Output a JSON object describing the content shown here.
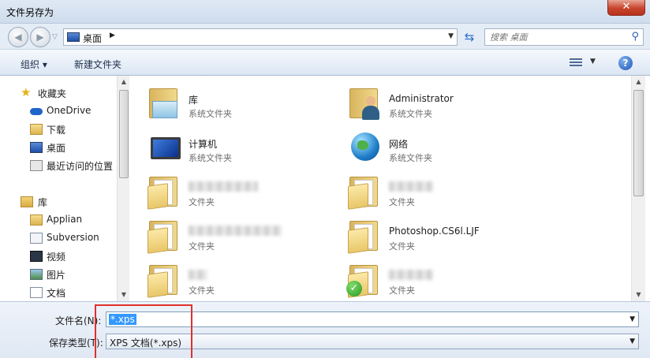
{
  "window": {
    "title": "文件另存为",
    "close_glyph": "✕"
  },
  "address": {
    "back_glyph": "◀",
    "forward_glyph": "▶",
    "crumb": "桌面",
    "crumb_arrow": "▶",
    "search_placeholder": "搜索 桌面"
  },
  "toolbar": {
    "organize": "组织 ▾",
    "new_folder": "新建文件夹",
    "help": "?"
  },
  "nav": {
    "favorites_label": "收藏夹",
    "items_favorites": [
      "OneDrive",
      "下载",
      "桌面",
      "最近访问的位置"
    ],
    "library_label": "库",
    "items_library": [
      "Applian",
      "Subversion",
      "视频",
      "图片",
      "文档"
    ]
  },
  "content": {
    "items": [
      {
        "name": "库",
        "type": "系统文件夹",
        "icon": "library-icon"
      },
      {
        "name": "Administrator",
        "type": "系统文件夹",
        "icon": "user-folder-icon"
      },
      {
        "name": "计算机",
        "type": "系统文件夹",
        "icon": "computer-icon"
      },
      {
        "name": "网络",
        "type": "系统文件夹",
        "icon": "network-icon"
      },
      {
        "name": "",
        "type": "文件夹",
        "icon": "folder-icon"
      },
      {
        "name": "",
        "type": "文件夹",
        "icon": "folder-icon"
      },
      {
        "name": "",
        "type": "文件夹",
        "icon": "folder-icon"
      },
      {
        "name": "Photoshop.CS6l.LJF",
        "type": "文件夹",
        "icon": "folder-icon"
      },
      {
        "name": "",
        "type": "文件夹",
        "icon": "folder-icon"
      },
      {
        "name": "",
        "type": "文件夹",
        "icon": "synced-folder-icon"
      }
    ]
  },
  "bottom": {
    "filename_label": "文件名(N):",
    "filename_value": "*.xps",
    "filetype_label": "保存类型(T):",
    "filetype_value": "XPS 文档(*.xps)"
  },
  "colors": {
    "highlight": "#e0302c",
    "selection": "#3399ff"
  }
}
